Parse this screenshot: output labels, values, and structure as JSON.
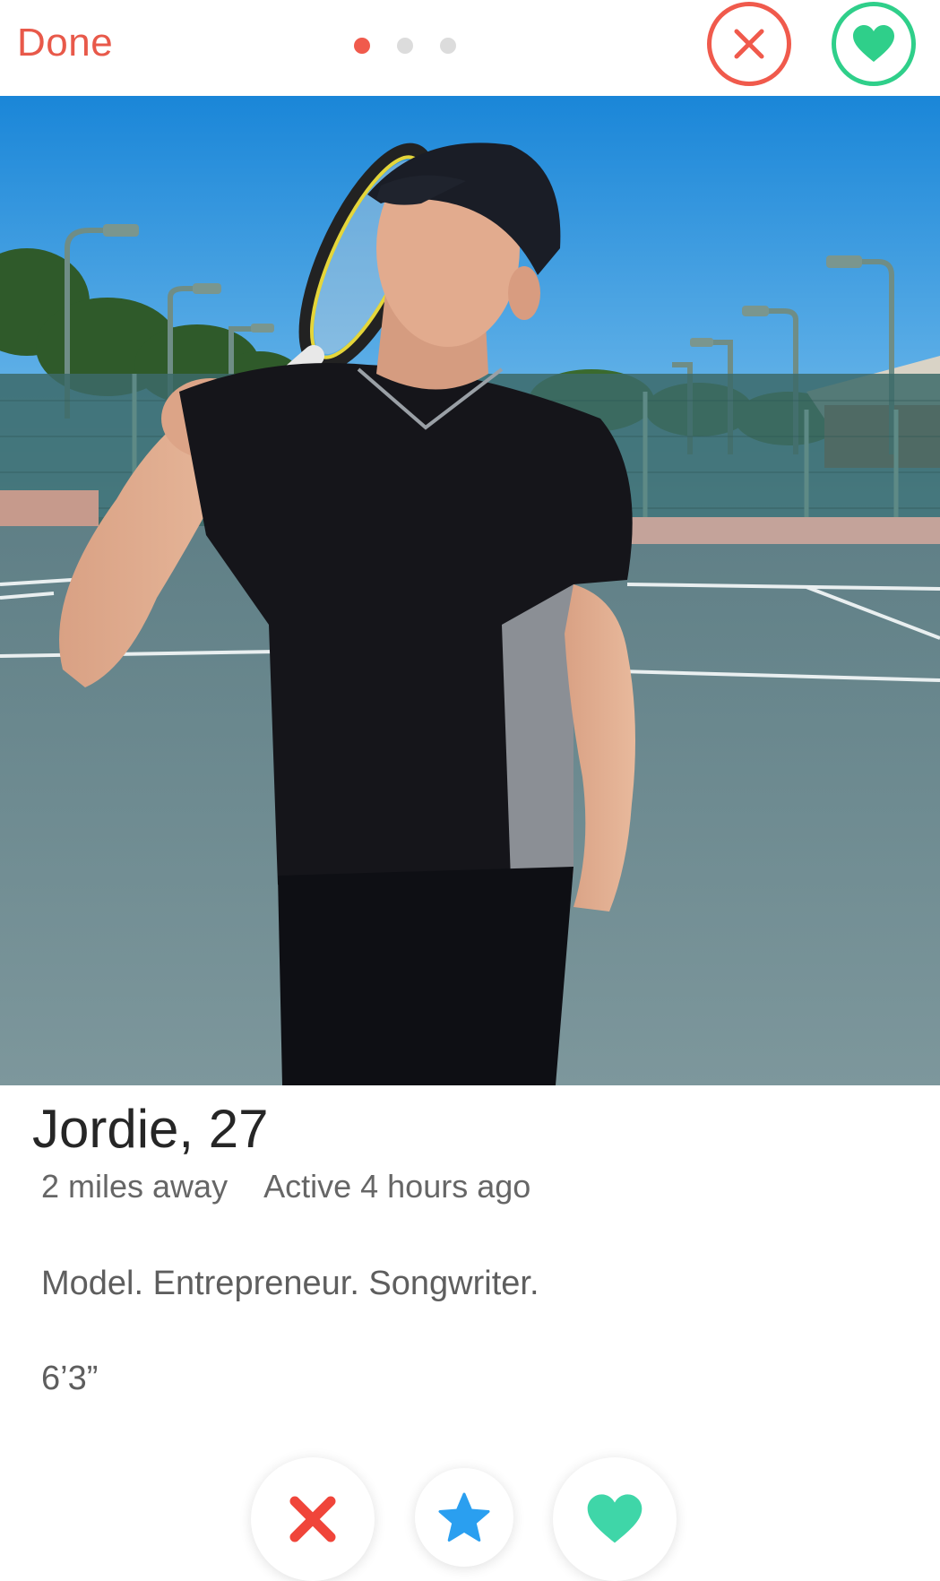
{
  "header": {
    "done_label": "Done",
    "photo_dots": [
      {
        "active": true
      },
      {
        "active": false
      },
      {
        "active": false
      }
    ],
    "nope_icon": "close-icon",
    "like_icon": "heart-icon"
  },
  "profile": {
    "name_age": "Jordie, 27",
    "distance": "2 miles away",
    "activity": "Active 4 hours ago",
    "bio": "Model. Entrepreneur. Songwriter.",
    "height": "6’3”"
  },
  "actions": [
    {
      "name": "nope",
      "icon": "x-icon"
    },
    {
      "name": "super-like",
      "icon": "star-icon"
    },
    {
      "name": "like",
      "icon": "heart-icon"
    }
  ],
  "colors": {
    "accent_red": "#f05a4c",
    "accent_green": "#2fcf8a",
    "star_blue": "#2a9ff0",
    "heart_teal": "#3fd6a8"
  }
}
